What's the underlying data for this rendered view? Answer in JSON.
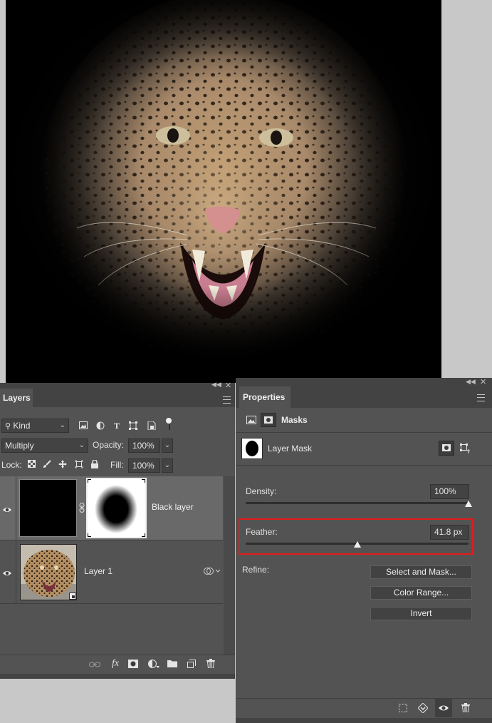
{
  "layers_panel": {
    "tab_label": "Layers",
    "filter_kind": "Kind",
    "blend_mode": "Multiply",
    "opacity_label": "Opacity:",
    "opacity_value": "100%",
    "lock_label": "Lock:",
    "fill_label": "Fill:",
    "fill_value": "100%",
    "layers": [
      {
        "name": "Black layer",
        "selected": true,
        "visible": true
      },
      {
        "name": "Layer 1",
        "selected": false,
        "visible": true
      }
    ],
    "filter_icons": [
      "image-filter-icon",
      "adjustment-filter-icon",
      "type-filter-icon",
      "shape-filter-icon",
      "smart-object-filter-icon",
      "filter-toggle-icon"
    ],
    "lock_icons": [
      "lock-transparent-icon",
      "lock-paint-icon",
      "lock-position-icon",
      "lock-artboard-icon",
      "lock-all-icon"
    ],
    "bottom_icons": [
      "link-layers-icon",
      "fx-icon",
      "add-mask-icon",
      "new-adjustment-icon",
      "new-group-icon",
      "new-layer-icon",
      "delete-layer-icon"
    ],
    "fx_text": "fx"
  },
  "properties_panel": {
    "tab_label": "Properties",
    "section_label": "Masks",
    "mask_label": "Layer Mask",
    "density_label": "Density:",
    "density_value": "100%",
    "density_fraction": 1.0,
    "feather_label": "Feather:",
    "feather_value": "41.8 px",
    "feather_fraction": 0.5,
    "refine_label": "Refine:",
    "select_and_mask_label": "Select and Mask...",
    "color_range_label": "Color Range...",
    "invert_label": "Invert",
    "bottom_icons": [
      "load-selection-icon",
      "apply-mask-icon",
      "toggle-mask-visibility-icon",
      "delete-mask-icon"
    ]
  },
  "colors": {
    "panel_bg": "#535353",
    "selected_row": "#696969",
    "highlight": "#e51a1a"
  }
}
